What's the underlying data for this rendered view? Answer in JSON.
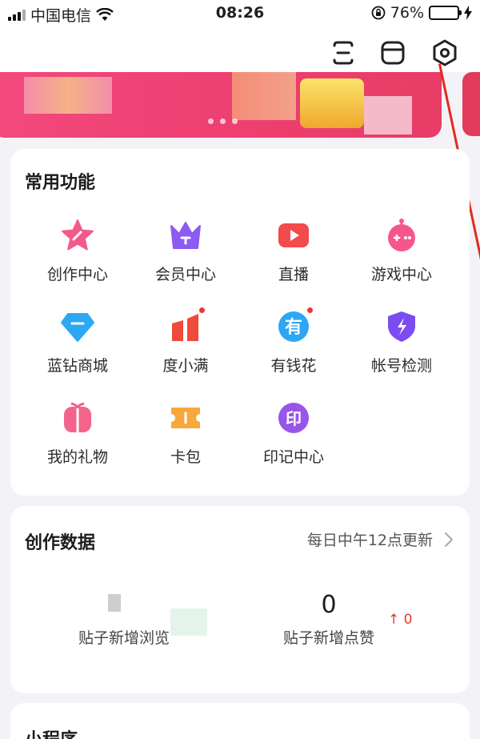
{
  "status_bar": {
    "carrier": "中国电信",
    "time": "08:26",
    "battery": "76%",
    "battery_level": 0.76
  },
  "header": {
    "icons": [
      "scan-icon",
      "box-icon",
      "settings-icon"
    ]
  },
  "common_functions": {
    "title": "常用功能",
    "items": [
      {
        "label": "创作中心",
        "icon": "star-icon",
        "color": "#f35a8a",
        "badge": false
      },
      {
        "label": "会员中心",
        "icon": "crown-icon",
        "color": "#8c5bf0",
        "badge": false
      },
      {
        "label": "直播",
        "icon": "video-camera-icon",
        "color": "#f14b4b",
        "badge": false
      },
      {
        "label": "游戏中心",
        "icon": "game-robot-icon",
        "color": "#f5578a",
        "badge": false
      },
      {
        "label": "蓝钻商城",
        "icon": "diamond-icon",
        "color": "#2da8f5",
        "badge": false
      },
      {
        "label": "度小满",
        "icon": "chart-bars-icon",
        "color": "#f04a3a",
        "badge": true
      },
      {
        "label": "有钱花",
        "icon": "you-money-icon",
        "color": "#2ea6f3",
        "badge": true,
        "glyph": "有"
      },
      {
        "label": "帐号检测",
        "icon": "shield-icon",
        "color": "#7b4df0",
        "badge": false
      },
      {
        "label": "我的礼物",
        "icon": "gift-icon",
        "color": "#f3648d",
        "badge": false
      },
      {
        "label": "卡包",
        "icon": "card-ticket-icon",
        "color": "#f7a83c",
        "badge": false
      },
      {
        "label": "印记中心",
        "icon": "seal-icon",
        "color": "#9a55e8",
        "badge": false,
        "glyph": "印"
      }
    ]
  },
  "creation_data": {
    "title": "创作数据",
    "update_note": "每日中午12点更新",
    "stats": [
      {
        "value": "",
        "label": "贴子新增浏览"
      },
      {
        "value": "0",
        "label": "贴子新增点赞",
        "delta": "↑ 0"
      }
    ]
  },
  "mini_programs": {
    "title": "小程序"
  }
}
